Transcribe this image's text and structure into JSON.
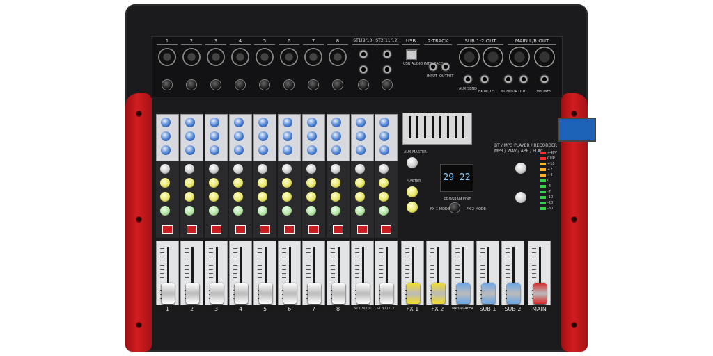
{
  "io_channels": [
    "1",
    "2",
    "3",
    "4",
    "5",
    "6",
    "7",
    "8",
    "ST1(9/10)",
    "ST2(11/12)",
    "USB",
    "2-TRACK",
    "SUB 1-2 OUT",
    "MAIN L/R OUT"
  ],
  "io_sub": {
    "usb": "USB AUDIO INTERFACE",
    "aux_send": "AUX SEND",
    "fx_mute": "FX MUTE",
    "monitor": "MONITOR OUT",
    "phones": "PHONES",
    "input": "INPUT",
    "output": "OUTPUT"
  },
  "player": {
    "title": "BT / MP3 PLAYER / RECORDER",
    "formats": "MP3 / WAV / APE / FLAC"
  },
  "led_display": "29 22",
  "master": {
    "aux_master": "AUX MASTER",
    "master": "MASTER",
    "program_edit": "PROGRAM EDIT",
    "fx1_mode": "FX 1 MODE",
    "fx2_mode": "FX 2 MODE"
  },
  "strip_labels": [
    "1",
    "2",
    "3",
    "4",
    "5",
    "6",
    "7",
    "8",
    "ST1(9/10)",
    "ST2(11/12)",
    "FX 1",
    "FX 2",
    "MP3 PLAYER",
    "SUB 1",
    "SUB 2",
    "MAIN"
  ],
  "meter_labels": [
    "+48V",
    "CLIP",
    "+10",
    "+7",
    "+4",
    "0",
    "-4",
    "-7",
    "-10",
    "-20",
    "-30"
  ],
  "colors": {
    "chassis": "#1b1b1d",
    "side": "#d21d20",
    "knob_blue": "#4a7fd0",
    "fader_yellow": "#f3dc2a",
    "fader_blue": "#6aa6e6",
    "fader_red": "#d72a2a"
  }
}
